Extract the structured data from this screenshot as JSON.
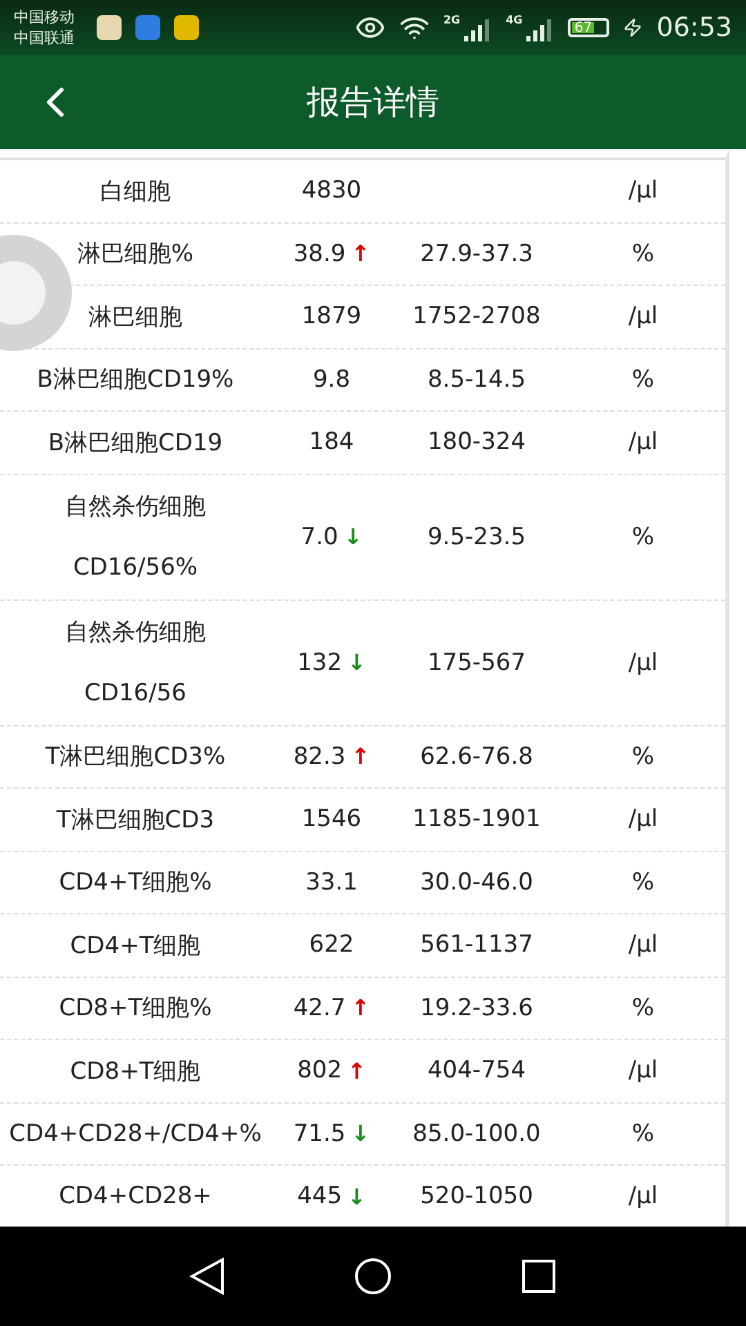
{
  "status_bar": {
    "carriers": [
      "中国移动",
      "中国联通"
    ],
    "network_labels": [
      "2G",
      "4G"
    ],
    "battery": "67",
    "time": "06:53"
  },
  "header": {
    "title": "报告详情"
  },
  "rows": [
    {
      "name": "白细胞",
      "value": "4830",
      "unit": "/μl"
    },
    {
      "name": "淋巴细胞%",
      "value": "38.9",
      "flag": {
        "text": "↑",
        "color": "#e00000"
      },
      "range": "27.9-37.3",
      "unit": "%"
    },
    {
      "name": "淋巴细胞",
      "value": "1879",
      "range": "1752-2708",
      "unit": "/μl"
    },
    {
      "name": "B淋巴细胞CD19%",
      "value": "9.8",
      "range": "8.5-14.5",
      "unit": "%"
    },
    {
      "name": "B淋巴细胞CD19",
      "value": "184",
      "range": "180-324",
      "unit": "/μl"
    },
    {
      "name": "自然杀伤细胞\nCD16/56%",
      "value": "7.0",
      "flag": {
        "text": "↓",
        "color": "#1a8a1a"
      },
      "range": "9.5-23.5",
      "unit": "%"
    },
    {
      "name": "自然杀伤细胞\nCD16/56",
      "value": "132",
      "flag": {
        "text": "↓",
        "color": "#1a8a1a"
      },
      "range": "175-567",
      "unit": "/μl"
    },
    {
      "name": "T淋巴细胞CD3%",
      "value": "82.3",
      "flag": {
        "text": "↑",
        "color": "#e00000"
      },
      "range": "62.6-76.8",
      "unit": "%"
    },
    {
      "name": "T淋巴细胞CD3",
      "value": "1546",
      "range": "1185-1901",
      "unit": "/μl"
    },
    {
      "name": "CD4+T细胞%",
      "value": "33.1",
      "range": "30.0-46.0",
      "unit": "%"
    },
    {
      "name": "CD4+T细胞",
      "value": "622",
      "range": "561-1137",
      "unit": "/μl"
    },
    {
      "name": "CD8+T细胞%",
      "value": "42.7",
      "flag": {
        "text": "↑",
        "color": "#e00000"
      },
      "range": "19.2-33.6",
      "unit": "%"
    },
    {
      "name": "CD8+T细胞",
      "value": "802",
      "flag": {
        "text": "↑",
        "color": "#e00000"
      },
      "range": "404-754",
      "unit": "/μl"
    },
    {
      "name": "CD4+CD28+/CD4+%",
      "value": "71.5",
      "flag": {
        "text": "↓",
        "color": "#1a8a1a"
      },
      "range": "85.0-100.0",
      "unit": "%"
    },
    {
      "name": "CD4+CD28+",
      "value": "445",
      "flag": {
        "text": "↓",
        "color": "#1a8a1a"
      },
      "range": "520-1050",
      "unit": "/μl"
    }
  ]
}
